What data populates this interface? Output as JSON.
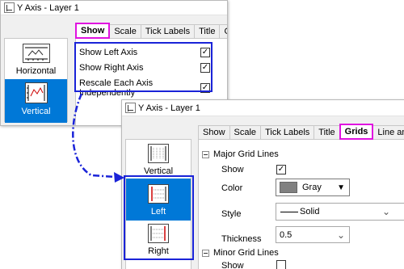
{
  "back_window": {
    "title": "Y Axis - Layer 1",
    "tabs": [
      "Show",
      "Scale",
      "Tick Labels",
      "Title",
      "Grids"
    ],
    "active_tab": "Show",
    "list_items": [
      "Horizontal",
      "Vertical"
    ],
    "selected_item": "Vertical",
    "options": [
      {
        "label": "Show Left Axis",
        "checked": true,
        "mark": "✓"
      },
      {
        "label": "Show Right Axis",
        "checked": true,
        "mark": "✓"
      },
      {
        "label": "Rescale Each Axis Independently",
        "checked": true,
        "mark": "✓"
      }
    ]
  },
  "front_window": {
    "title": "Y Axis - Layer 1",
    "tabs": [
      "Show",
      "Scale",
      "Tick Labels",
      "Title",
      "Grids",
      "Line and Ticks"
    ],
    "active_tab": "Grids",
    "list_items": [
      "Vertical",
      "Left",
      "Right"
    ],
    "selected_item": "Left",
    "major_grid": {
      "header": "Major Grid Lines",
      "show_label": "Show",
      "show_mark": "✓",
      "color_label": "Color",
      "color_value": "Gray",
      "style_label": "Style",
      "style_value": "Solid",
      "thickness_label": "Thickness",
      "thickness_value": "0.5"
    },
    "minor_grid": {
      "header": "Minor Grid Lines",
      "show_label": "Show"
    }
  },
  "colors": {
    "selection": "#0078d7",
    "highlight_box": "#1a23d8",
    "tab_highlight": "#e012e0",
    "arrow": "#1a23d8",
    "grid_gray": "#808080"
  },
  "icons": {
    "dropdown_dark": "▼",
    "dropdown_light": "⌄"
  }
}
